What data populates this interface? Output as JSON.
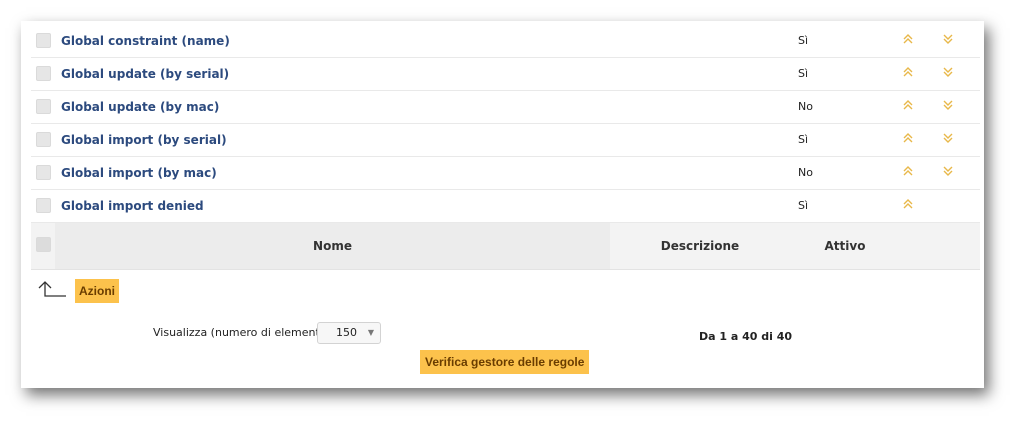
{
  "rules": [
    {
      "name": "Global constraint (name)",
      "active": "Sì",
      "can_up": true,
      "can_down": true
    },
    {
      "name": "Global update (by serial)",
      "active": "Sì",
      "can_up": true,
      "can_down": true
    },
    {
      "name": "Global update (by mac)",
      "active": "No",
      "can_up": true,
      "can_down": true
    },
    {
      "name": "Global import (by serial)",
      "active": "Sì",
      "can_up": true,
      "can_down": true
    },
    {
      "name": "Global import (by mac)",
      "active": "No",
      "can_up": true,
      "can_down": true
    },
    {
      "name": "Global import denied",
      "active": "Sì",
      "can_up": true,
      "can_down": false
    }
  ],
  "table_header": {
    "name": "Nome",
    "description": "Descrizione",
    "active": "Attivo"
  },
  "actions": {
    "label": "Azioni"
  },
  "pagination": {
    "display_label": "Visualizza (numero di elementi)",
    "page_size": "150",
    "range_text": "Da 1 a 40 di 40"
  },
  "verify_button": {
    "label": "Verifica gestore delle regole"
  },
  "colors": {
    "accent": "#fcc24c",
    "link": "#2c4a7e",
    "arrow": "#e8b84a"
  },
  "icons": {
    "up": "double-chevron-up-icon",
    "down": "double-chevron-down-icon",
    "actions": "arrow-return-up-icon"
  }
}
